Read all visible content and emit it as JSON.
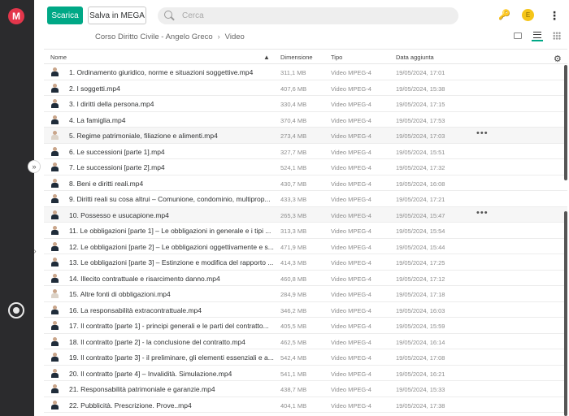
{
  "rail": {
    "logo": "M",
    "bottom_icon": "sync-icon"
  },
  "toolbar": {
    "download_label": "Scarica",
    "save_label": "Salva in MEGA"
  },
  "search": {
    "placeholder": "Cerca"
  },
  "account": {
    "avatar_letter": "E",
    "accent_color": "#00a886",
    "avatar_color": "#f5c518"
  },
  "breadcrumb": {
    "parent": "Corso Diritto Civile - Angelo Greco",
    "current": "Video"
  },
  "columns": {
    "name": "Nome",
    "size": "Dimensione",
    "type": "Tipo",
    "date": "Data aggiunta"
  },
  "files": [
    {
      "name": "1. Ordinamento giuridico, norme e situazioni soggettive.mp4",
      "size": "311,1 MB",
      "type": "Video MPEG-4",
      "date": "19/05/2024, 17:01"
    },
    {
      "name": "2. I soggetti.mp4",
      "size": "407,6 MB",
      "type": "Video MPEG-4",
      "date": "19/05/2024, 15:38"
    },
    {
      "name": "3. I diritti della persona.mp4",
      "size": "330,4 MB",
      "type": "Video MPEG-4",
      "date": "19/05/2024, 17:15"
    },
    {
      "name": "4. La famiglia.mp4",
      "size": "370,4 MB",
      "type": "Video MPEG-4",
      "date": "19/05/2024, 17:53"
    },
    {
      "name": "5. Regime patrimoniale, filiazione e alimenti.mp4",
      "size": "273,4 MB",
      "type": "Video MPEG-4",
      "date": "19/05/2024, 17:03"
    },
    {
      "name": "6. Le successioni [parte 1].mp4",
      "size": "327,7 MB",
      "type": "Video MPEG-4",
      "date": "19/05/2024, 15:51"
    },
    {
      "name": "7. Le successioni [parte 2].mp4",
      "size": "524,1 MB",
      "type": "Video MPEG-4",
      "date": "19/05/2024, 17:32"
    },
    {
      "name": "8. Beni e diritti reali.mp4",
      "size": "430,7 MB",
      "type": "Video MPEG-4",
      "date": "19/05/2024, 16:08"
    },
    {
      "name": "9. Diritti reali su cosa altrui – Comunione, condominio, multiprop...",
      "size": "433,3 MB",
      "type": "Video MPEG-4",
      "date": "19/05/2024, 17:21"
    },
    {
      "name": "10. Possesso e usucapione.mp4",
      "size": "265,3 MB",
      "type": "Video MPEG-4",
      "date": "19/05/2024, 15:47"
    },
    {
      "name": "11. Le obbligazioni [parte 1] – Le obbligazioni in generale e i tipi ...",
      "size": "313,3 MB",
      "type": "Video MPEG-4",
      "date": "19/05/2024, 15:54"
    },
    {
      "name": "12. Le obbligazioni [parte 2] – Le obbligazioni oggettivamente e s...",
      "size": "471,9 MB",
      "type": "Video MPEG-4",
      "date": "19/05/2024, 15:44"
    },
    {
      "name": "13. Le obbligazioni [parte 3] – Estinzione e modifica del rapporto ...",
      "size": "414,3 MB",
      "type": "Video MPEG-4",
      "date": "19/05/2024, 17:25"
    },
    {
      "name": "14. Illecito contrattuale e risarcimento danno.mp4",
      "size": "460,8 MB",
      "type": "Video MPEG-4",
      "date": "19/05/2024, 17:12"
    },
    {
      "name": "15. Altre fonti di obbligazioni.mp4",
      "size": "284,9 MB",
      "type": "Video MPEG-4",
      "date": "19/05/2024, 17:18"
    },
    {
      "name": "16. La responsabilità extracontrattuale.mp4",
      "size": "346,2 MB",
      "type": "Video MPEG-4",
      "date": "19/05/2024, 16:03"
    },
    {
      "name": "17. Il contratto [parte 1] - principi generali e le parti del contratto...",
      "size": "405,5 MB",
      "type": "Video MPEG-4",
      "date": "19/05/2024, 15:59"
    },
    {
      "name": "18. Il contratto [parte 2] - la conclusione del contratto.mp4",
      "size": "462,5 MB",
      "type": "Video MPEG-4",
      "date": "19/05/2024, 16:14"
    },
    {
      "name": "19. Il contratto [parte 3] - il preliminare, gli elementi essenziali e a...",
      "size": "542,4 MB",
      "type": "Video MPEG-4",
      "date": "19/05/2024, 17:08"
    },
    {
      "name": "20. Il contratto [parte 4] – Invalidità. Simulazione.mp4",
      "size": "541,1 MB",
      "type": "Video MPEG-4",
      "date": "19/05/2024, 16:21"
    },
    {
      "name": "21. Responsabilità patrimoniale e garanzie.mp4",
      "size": "438,7 MB",
      "type": "Video MPEG-4",
      "date": "19/05/2024, 15:33"
    },
    {
      "name": "22. Pubblicità. Prescrizione. Prove..mp4",
      "size": "404,1 MB",
      "type": "Video MPEG-4",
      "date": "19/05/2024, 17:38"
    }
  ],
  "row_menu_label": "•••"
}
